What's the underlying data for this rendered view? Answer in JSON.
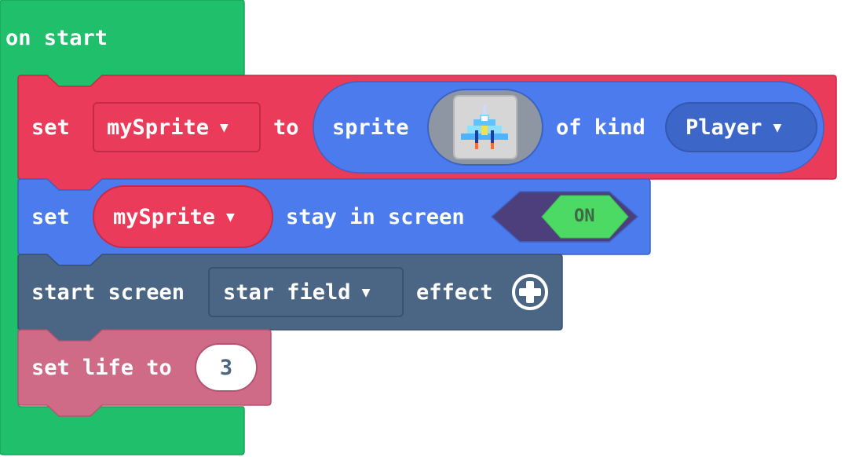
{
  "colors": {
    "events": "#20BF6B",
    "variables": "#EB3B5A",
    "sprites": "#4B7BEC",
    "scene": "#4B6584",
    "info": "#CF6A87",
    "toggle_on": "#4CD964",
    "toggle_track": "#4C3F7C"
  },
  "on_start": {
    "label": "on start"
  },
  "set_sprite_block": {
    "set_label": "set",
    "variable": "mySprite",
    "to_label": "to",
    "sprite_label": "sprite",
    "image_icon": "spaceship-icon",
    "of_kind_label": "of kind",
    "kind": "Player"
  },
  "stay_in_screen_block": {
    "set_label": "set",
    "variable": "mySprite",
    "stay_label": "stay in screen",
    "toggle_label": "ON"
  },
  "screen_effect_block": {
    "start_label": "start screen",
    "effect": "star field",
    "effect_label": "effect",
    "add_icon": "plus-circle-icon"
  },
  "life_block": {
    "label": "set life to",
    "value": "3"
  }
}
